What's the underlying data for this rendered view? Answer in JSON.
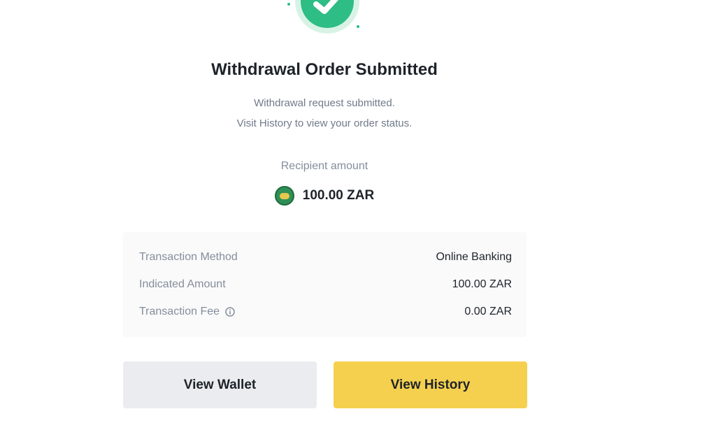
{
  "dialog": {
    "title": "Withdrawal Order Submitted",
    "message_line1": "Withdrawal request submitted.",
    "message_line2": "Visit History to view your order status.",
    "status_icon": "check-circle-icon"
  },
  "recipient": {
    "label": "Recipient amount",
    "amount": "100.00 ZAR",
    "currency_icon": "zar-currency-icon"
  },
  "details": [
    {
      "label": "Transaction Method",
      "value": "Online Banking"
    },
    {
      "label": "Indicated Amount",
      "value": "100.00 ZAR"
    },
    {
      "label": "Transaction Fee",
      "value": "0.00 ZAR",
      "info_icon": "info-icon"
    }
  ],
  "actions": {
    "view_wallet": "View Wallet",
    "view_history": "View History"
  },
  "colors": {
    "success": "#2ebd85",
    "primary_button": "#f5d04f",
    "secondary_button": "#eaecef",
    "details_background": "#fafafa"
  }
}
